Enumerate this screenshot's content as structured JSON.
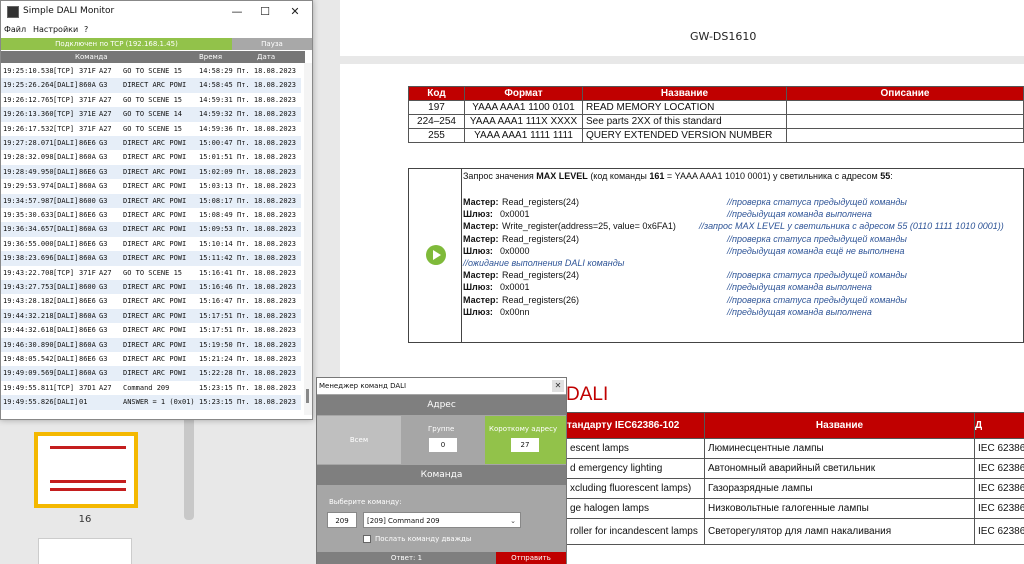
{
  "doc": {
    "header": "GW-DS1610",
    "cmd_table": {
      "headers": [
        "Код",
        "Формат",
        "Название",
        "Описание"
      ],
      "rows": [
        [
          "197",
          "YAAA AAA1 1100 0101",
          "READ MEMORY LOCATION",
          ""
        ],
        [
          "224–254",
          "YAAA AAA1 111X XXXX",
          "See parts 2XX of this standard",
          ""
        ],
        [
          "255",
          "YAAA AAA1 1111 1111",
          "QUERY EXTENDED VERSION NUMBER",
          ""
        ]
      ]
    },
    "example": {
      "intro_pre": "Запрос значения ",
      "intro_bold1": "MAX LEVEL",
      "intro_mid": " (код команды ",
      "intro_bold2": "161",
      "intro_mid2": " = YAAA AAA1 1010 0001) у светильника с адресом ",
      "intro_bold3": "55",
      "intro_end": ":",
      "lines": [
        {
          "who": "Мастер:",
          "text": "Read_registers(24)",
          "comment": "//проверка статуса предыдущей команды"
        },
        {
          "who": "Шлюз:",
          "text": "0x0001",
          "comment": "//предыдущая команда выполнена"
        },
        {
          "who": "Мастер:",
          "text": "Write_register(address=25, value= 0x6FA1)",
          "comment": "//запрос MAX LEVEL у светильника с адресом 55 (0110 1111 1010 0001))"
        },
        {
          "who": "Мастер:",
          "text": "Read_registers(24)",
          "comment": "//проверка статуса предыдущей команды"
        },
        {
          "who": "Шлюз:",
          "text": "0x0000",
          "comment": "//предыдущая команда ещё не выполнена"
        },
        {
          "who": "",
          "text": "",
          "comment": "//ожидание выполнения DALI команды"
        },
        {
          "who": "Мастер:",
          "text": "Read_registers(24)",
          "comment": "//проверка статуса предыдущей команды"
        },
        {
          "who": "Шлюз:",
          "text": "0x0001",
          "comment": "//предыдущая команда выполнена"
        },
        {
          "who": "Мастер:",
          "text": "Read_registers(26)",
          "comment": "//проверка статуса предыдущей команды"
        },
        {
          "who": "Шлюз:",
          "text": "0x00nn",
          "comment": "//предыдущая команда выполнена"
        }
      ]
    },
    "section_title": "DALI",
    "lamp_table": {
      "headers": [
        "тандарту IEC62386-102",
        "Название",
        "Д"
      ],
      "rows": [
        [
          "escent lamps",
          "Люминесцентные лампы",
          "IEC 62386-"
        ],
        [
          "d emergency lighting",
          "Автономный аварийный светильник",
          "IEC 62386-"
        ],
        [
          "xcluding fluorescent lamps)",
          "Газоразрядные лампы",
          "IEC 62386-"
        ],
        [
          "ge halogen lamps",
          "Низковольтные галогенные лампы",
          "IEC 62386-"
        ],
        [
          "roller for incandescent lamps",
          "Светорегулятор для ламп накаливания",
          "IEC 62386-"
        ]
      ]
    },
    "thumb_page": "16"
  },
  "monitor": {
    "title": "Simple DALI Monitor",
    "menu": [
      "Файл",
      "Настройки",
      "?"
    ],
    "status": "Подключен по TCP (192.168.1.45)",
    "pause": "Пауза",
    "headers": {
      "cmd": "Команда",
      "time": "Время",
      "date": "Дата"
    },
    "rows": [
      [
        "19:25:10.538",
        "[TCP]",
        "371F",
        "A27",
        "GO TO SCENE 15",
        "14:58:29",
        "Пт. 18.08.2023"
      ],
      [
        "19:25:26.264",
        "[DALI]",
        "860A",
        "G3",
        "DIRECT ARC POWI",
        "14:58:45",
        "Пт. 18.08.2023"
      ],
      [
        "19:26:12.765",
        "[TCP]",
        "371F",
        "A27",
        "GO TO SCENE 15",
        "14:59:31",
        "Пт. 18.08.2023"
      ],
      [
        "19:26:13.360",
        "[TCP]",
        "371E",
        "A27",
        "GO TO SCENE 14",
        "14:59:32",
        "Пт. 18.08.2023"
      ],
      [
        "19:26:17.532",
        "[TCP]",
        "371F",
        "A27",
        "GO TO SCENE 15",
        "14:59:36",
        "Пт. 18.08.2023"
      ],
      [
        "19:27:28.071",
        "[DALI]",
        "86E6",
        "G3",
        "DIRECT ARC POWI",
        "15:00:47",
        "Пт. 18.08.2023"
      ],
      [
        "19:28:32.098",
        "[DALI]",
        "860A",
        "G3",
        "DIRECT ARC POWI",
        "15:01:51",
        "Пт. 18.08.2023"
      ],
      [
        "19:28:49.950",
        "[DALI]",
        "86E6",
        "G3",
        "DIRECT ARC POWI",
        "15:02:09",
        "Пт. 18.08.2023"
      ],
      [
        "19:29:53.974",
        "[DALI]",
        "860A",
        "G3",
        "DIRECT ARC POWI",
        "15:03:13",
        "Пт. 18.08.2023"
      ],
      [
        "19:34:57.987",
        "[DALI]",
        "8600",
        "G3",
        "DIRECT ARC POWI",
        "15:08:17",
        "Пт. 18.08.2023"
      ],
      [
        "19:35:30.633",
        "[DALI]",
        "86E6",
        "G3",
        "DIRECT ARC POWI",
        "15:08:49",
        "Пт. 18.08.2023"
      ],
      [
        "19:36:34.657",
        "[DALI]",
        "860A",
        "G3",
        "DIRECT ARC POWI",
        "15:09:53",
        "Пт. 18.08.2023"
      ],
      [
        "19:36:55.000",
        "[DALI]",
        "86E6",
        "G3",
        "DIRECT ARC POWI",
        "15:10:14",
        "Пт. 18.08.2023"
      ],
      [
        "19:38:23.696",
        "[DALI]",
        "860A",
        "G3",
        "DIRECT ARC POWI",
        "15:11:42",
        "Пт. 18.08.2023"
      ],
      [
        "19:43:22.708",
        "[TCP]",
        "371F",
        "A27",
        "GO TO SCENE 15",
        "15:16:41",
        "Пт. 18.08.2023"
      ],
      [
        "19:43:27.753",
        "[DALI]",
        "8600",
        "G3",
        "DIRECT ARC POWI",
        "15:16:46",
        "Пт. 18.08.2023"
      ],
      [
        "19:43:28.182",
        "[DALI]",
        "86E6",
        "G3",
        "DIRECT ARC POWI",
        "15:16:47",
        "Пт. 18.08.2023"
      ],
      [
        "19:44:32.218",
        "[DALI]",
        "860A",
        "G3",
        "DIRECT ARC POWI",
        "15:17:51",
        "Пт. 18.08.2023"
      ],
      [
        "19:44:32.618",
        "[DALI]",
        "86E6",
        "G3",
        "DIRECT ARC POWI",
        "15:17:51",
        "Пт. 18.08.2023"
      ],
      [
        "19:46:30.890",
        "[DALI]",
        "860A",
        "G3",
        "DIRECT ARC POWI",
        "15:19:50",
        "Пт. 18.08.2023"
      ],
      [
        "19:48:05.542",
        "[DALI]",
        "86E6",
        "G3",
        "DIRECT ARC POWI",
        "15:21:24",
        "Пт. 18.08.2023"
      ],
      [
        "19:49:09.569",
        "[DALI]",
        "860A",
        "G3",
        "DIRECT ARC POWI",
        "15:22:28",
        "Пт. 18.08.2023"
      ],
      [
        "19:49:55.811",
        "[TCP]",
        "37D1",
        "A27",
        "Command 209",
        "15:23:15",
        "Пт. 18.08.2023"
      ],
      [
        "19:49:55.826",
        "[DALI]",
        "01",
        "",
        "ANSWER   = 1 (0x01)",
        "15:23:15",
        "Пт. 18.08.2023"
      ]
    ]
  },
  "manager": {
    "title": "Менеджер команд DALI",
    "address_header": "Адрес",
    "all_label": "Всем",
    "group_label": "Группе",
    "group_value": "0",
    "short_label": "Короткому адресу",
    "short_value": "27",
    "command_header": "Команда",
    "choose_label": "Выберите команду:",
    "cmd_number": "209",
    "cmd_selected": "[209] Command 209",
    "send_twice": "Послать команду дважды",
    "answer": "Ответ: 1",
    "send_button": "Отправить"
  }
}
